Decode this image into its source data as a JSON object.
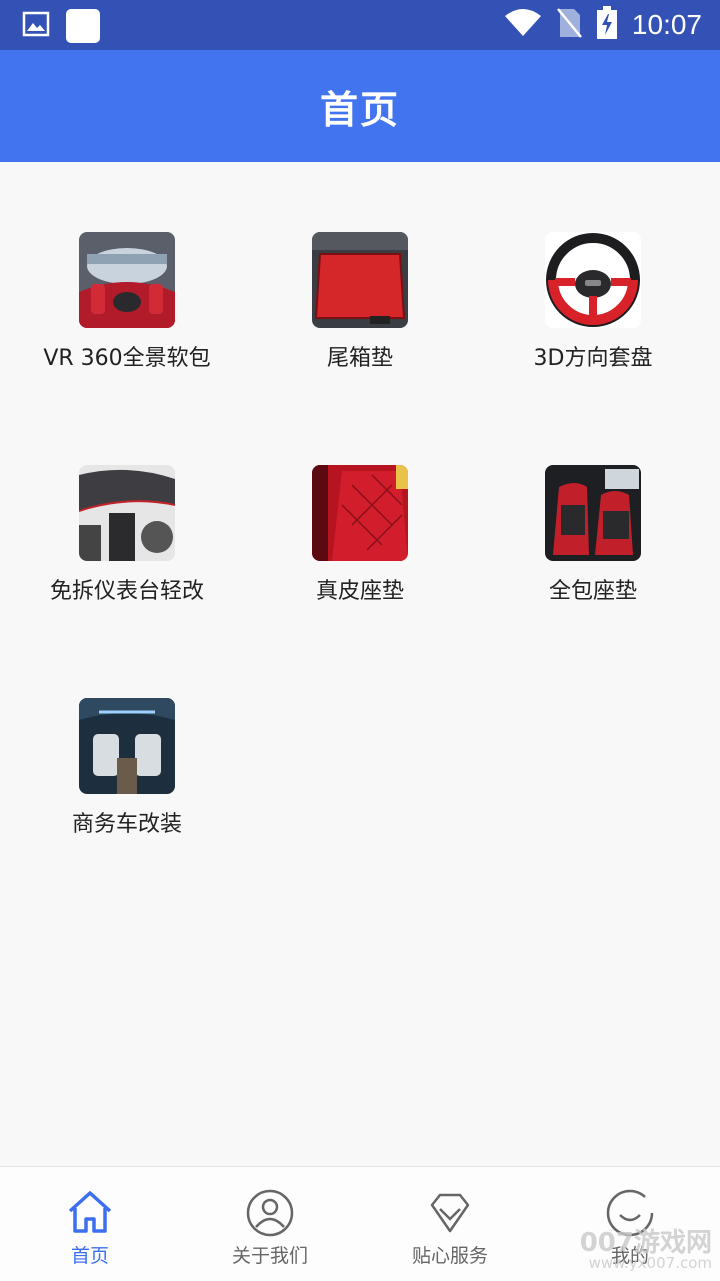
{
  "status_bar": {
    "time": "10:07",
    "icons": [
      "image-icon",
      "app-square-icon",
      "wifi-icon",
      "no-sim-icon",
      "battery-charging-icon"
    ]
  },
  "header": {
    "title": "首页"
  },
  "colors": {
    "status_bar": "#3452b6",
    "app_bar": "#4274ef",
    "accent": "#3c6ff0"
  },
  "categories": [
    {
      "label": "VR 360全景软包",
      "icon": "car-interior-360-image"
    },
    {
      "label": "尾箱垫",
      "icon": "trunk-mat-image"
    },
    {
      "label": "3D方向套盘",
      "icon": "steering-wheel-image"
    },
    {
      "label": "免拆仪表台轻改",
      "icon": "dashboard-image"
    },
    {
      "label": "真皮座垫",
      "icon": "leather-seat-image"
    },
    {
      "label": "全包座垫",
      "icon": "full-seat-cover-image"
    },
    {
      "label": "商务车改装",
      "icon": "business-van-image"
    }
  ],
  "bottom_nav": {
    "items": [
      {
        "label": "首页",
        "icon": "home-icon",
        "active": true
      },
      {
        "label": "关于我们",
        "icon": "user-icon",
        "active": false
      },
      {
        "label": "贴心服务",
        "icon": "diamond-icon",
        "active": false
      },
      {
        "label": "我的",
        "icon": "smile-icon",
        "active": false
      }
    ]
  },
  "watermark": {
    "main": "007游戏网",
    "url": "www.yx007.com"
  }
}
